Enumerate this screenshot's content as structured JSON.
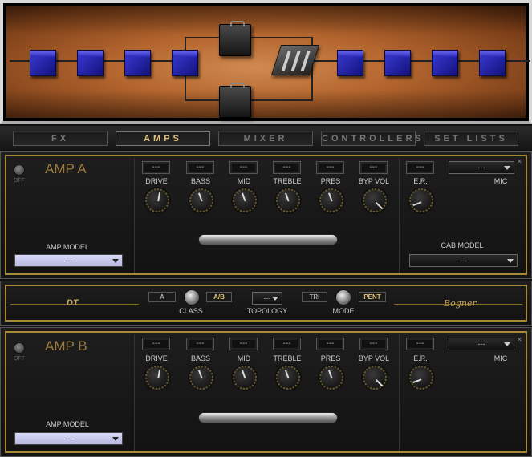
{
  "chain": {},
  "tabs": [
    {
      "label": "FX"
    },
    {
      "label": "AMPS"
    },
    {
      "label": "MIXER"
    },
    {
      "label": "CONTROLLERS"
    },
    {
      "label": "SET LISTS"
    }
  ],
  "amp_a": {
    "title": "AMP A",
    "off_label": "OFF",
    "params": [
      {
        "label": "DRIVE",
        "value": "---"
      },
      {
        "label": "BASS",
        "value": "---"
      },
      {
        "label": "MID",
        "value": "---"
      },
      {
        "label": "TREBLE",
        "value": "---"
      },
      {
        "label": "PRES",
        "value": "---"
      },
      {
        "label": "BYP VOL",
        "value": "---"
      },
      {
        "label": "E.R.",
        "value": "---"
      }
    ],
    "mic_label": "MIC",
    "mic_value": "---",
    "amp_model_label": "AMP MODEL",
    "amp_model_value": "---",
    "cab_model_label": "CAB MODEL",
    "cab_model_value": "---"
  },
  "dt": {
    "logo_left": "DT",
    "logo_right": "Bogner",
    "class_a": "A",
    "class_ab": "A/B",
    "class_label": "CLASS",
    "topology_value": "---",
    "topology_label": "TOPOLOGY",
    "mode_tri": "TRI",
    "mode_pent": "PENT",
    "mode_label": "MODE"
  },
  "amp_b": {
    "title": "AMP B",
    "off_label": "OFF",
    "params": [
      {
        "label": "DRIVE",
        "value": "---"
      },
      {
        "label": "BASS",
        "value": "---"
      },
      {
        "label": "MID",
        "value": "---"
      },
      {
        "label": "TREBLE",
        "value": "---"
      },
      {
        "label": "PRES",
        "value": "---"
      },
      {
        "label": "BYP VOL",
        "value": "---"
      },
      {
        "label": "E.R.",
        "value": "---"
      }
    ],
    "mic_label": "MIC",
    "mic_value": "---",
    "amp_model_label": "AMP MODEL",
    "amp_model_value": "---"
  },
  "colors": {
    "accent": "#a88938",
    "title": "#9a7a3e",
    "tab_active": "#e2c47a"
  },
  "icons": [
    "fx-block-cube-icon",
    "amp-cabinet-icon",
    "mixer-icon",
    "close-icon",
    "knob-icon",
    "toggle-switch-icon"
  ]
}
